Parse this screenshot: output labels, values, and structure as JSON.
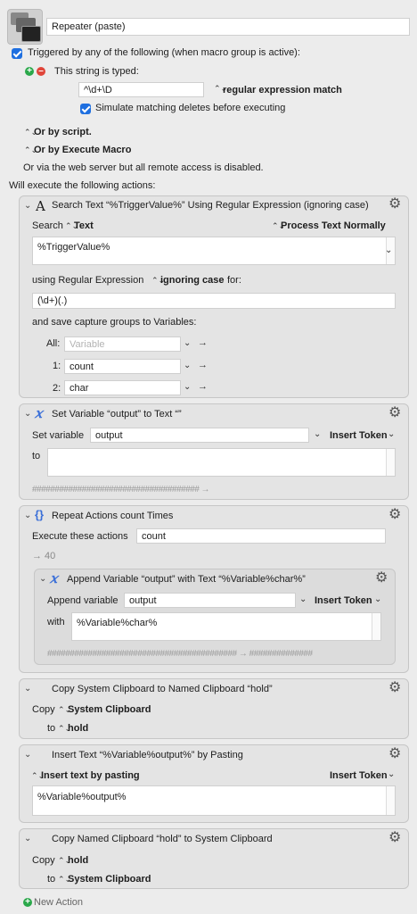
{
  "macro": {
    "name": "Repeater (paste)",
    "trigger_label": "Triggered by any of the following (when macro group is active):",
    "string_typed_label": "This string is typed:",
    "typed_string": "^\\d+\\D",
    "match_mode": "regular expression match",
    "simulate_deletes": "Simulate matching deletes before executing",
    "or_script": "Or by script.",
    "or_execute_macro": "Or by Execute Macro",
    "web_server": "Or via the web server but all remote access is disabled.",
    "will_execute": "Will execute the following actions:"
  },
  "actions": {
    "search": {
      "title": "Search Text “%TriggerValue%” Using Regular Expression (ignoring case)",
      "search_label": "Search",
      "search_target": "Text",
      "process_mode": "Process Text Normally",
      "text_value": "%TriggerValue%",
      "using_label": "using Regular Expression",
      "case_mode": "ignoring case",
      "for_label": "for:",
      "regex": "(\\d+)(.)",
      "save_label": "and save capture groups to Variables:",
      "all_label": "All:",
      "all_placeholder": "Variable",
      "g1_label": "1:",
      "g1_value": "count",
      "g2_label": "2:",
      "g2_value": "char"
    },
    "setvar": {
      "title": "Set Variable “output” to Text “”",
      "set_label": "Set variable",
      "var_value": "output",
      "insert_token": "Insert Token",
      "to_label": "to",
      "hash": "##################################### →"
    },
    "repeat": {
      "title": "Repeat Actions count Times",
      "execute_label": "Execute these actions",
      "count_value": "count",
      "result": "→ 40",
      "append": {
        "title": "Append Variable “output” with Text “%Variable%char%”",
        "append_label": "Append variable",
        "var_value": "output",
        "insert_token": "Insert Token",
        "with_label": "with",
        "with_value": "%Variable%char%",
        "hash": "########################################## → ##############"
      }
    },
    "copyclip": {
      "title": "Copy System Clipboard to Named Clipboard “hold”",
      "copy_label": "Copy",
      "copy_source": "System Clipboard",
      "to_label": "to",
      "to_target": "hold"
    },
    "insert": {
      "title": "Insert Text “%Variable%output%” by Pasting",
      "mode": "Insert text by pasting",
      "insert_token": "Insert Token",
      "text_value": "%Variable%output%"
    },
    "copyback": {
      "title": "Copy Named Clipboard “hold” to System Clipboard",
      "copy_label": "Copy",
      "copy_source": "hold",
      "to_label": "to",
      "to_target": "System Clipboard"
    }
  },
  "footer": {
    "new_action": "New Action"
  },
  "colors": {
    "checkbox": "#1e6fe0",
    "add_green": "#2aa84a",
    "remove_red": "#e0453a",
    "variable_x": "#3a6fd8"
  },
  "icons": [
    "macro-icon",
    "gear-icon",
    "search-text-icon",
    "variable-icon",
    "repeat-icon",
    "disclosure-triangle-icon",
    "chevron-down-icon",
    "stepper-icon",
    "arrow-right-icon",
    "add-icon",
    "remove-icon"
  ]
}
